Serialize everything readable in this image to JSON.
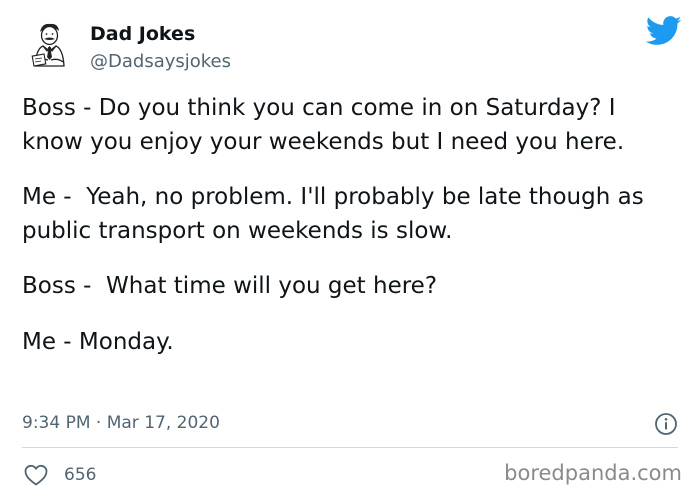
{
  "author": {
    "display_name": "Dad Jokes",
    "handle": "@Dadsaysjokes"
  },
  "tweet": {
    "paragraphs": [
      "Boss - Do you think you can come in on Saturday? I know you enjoy your weekends but I need you here.",
      "Me -  Yeah, no problem. I'll probably be late though as public transport on weekends is slow.",
      "Boss -  What time will you get here?",
      "Me - Monday."
    ],
    "timestamp": "9:34 PM · Mar 17, 2020"
  },
  "engagement": {
    "like_count": "656"
  },
  "watermark": "boredpanda.com",
  "colors": {
    "twitter_blue": "#1d9bf0",
    "secondary_text": "#536471",
    "primary_text": "#0f1419",
    "divider": "#cfd9de"
  },
  "icons": {
    "brand": "twitter-bird-icon",
    "info": "info-icon",
    "like": "heart-icon",
    "avatar": "chef-illustration-avatar"
  }
}
